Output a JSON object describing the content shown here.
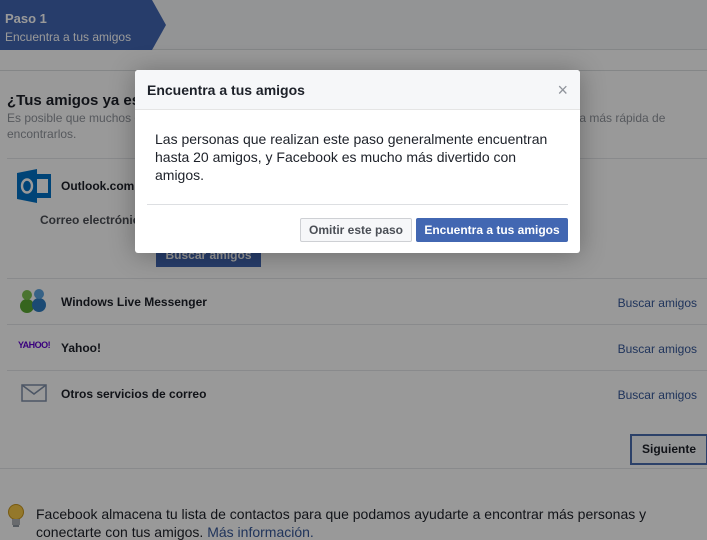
{
  "step": {
    "title": "Paso 1",
    "subtitle": "Encuentra a tus amigos"
  },
  "main": {
    "headline": "¿Tus amigos ya están en Facebook?",
    "description": "Es posible que muchos de tus amigos ya estén aquí. Buscar en tu cuenta de correo electrónico es la manera más rápida de encontrarlos."
  },
  "outlook": {
    "name": "Outlook.com",
    "email_label": "Correo electrónico",
    "button": "Buscar amigos"
  },
  "providers": [
    {
      "name": "Windows Live Messenger",
      "link": "Buscar amigos",
      "icon": "messenger-icon"
    },
    {
      "name": "Yahoo!",
      "link": "Buscar amigos",
      "icon": "yahoo-icon"
    },
    {
      "name": "Otros servicios de correo",
      "link": "Buscar amigos",
      "icon": "envelope-icon"
    }
  ],
  "next_button": "Siguiente",
  "tip": {
    "text": "Facebook almacena tu lista de contactos para que podamos ayudarte a encontrar más personas y conectarte con tus amigos.",
    "link": "Más información."
  },
  "dialog": {
    "title": "Encuentra a tus amigos",
    "close": "×",
    "body": "Las personas que realizan este paso generalmente encuentran hasta 20 amigos, y Facebook es mucho más divertido con amigos.",
    "skip_button": "Omitir este paso",
    "find_button": "Encuentra a tus amigos"
  },
  "yahoo_logo_text": "YAHOO!",
  "colors": {
    "brand": "#4267b2",
    "link": "#365899",
    "outlook": "#0072c6"
  }
}
